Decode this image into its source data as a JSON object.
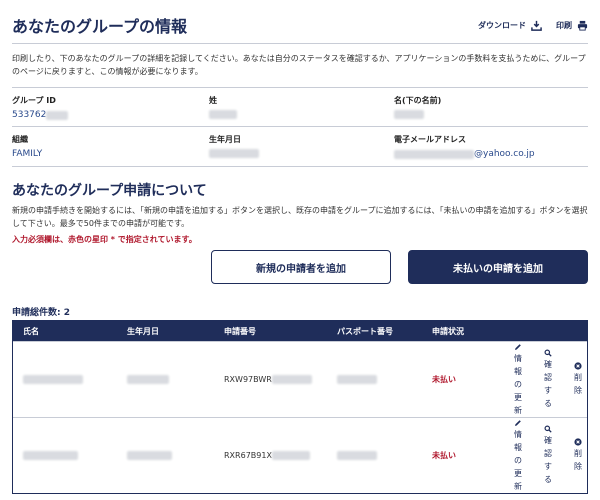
{
  "header": {
    "title": "あなたのグループの情報",
    "download_label": "ダウンロード",
    "print_label": "印刷"
  },
  "intro_text": "印刷したり、下のあなたのグループの詳細を記録してください。あなたは自分のステータスを確認するか、アプリケーションの手数料を支払うために、グループのページに戻りますと、この情報が必要になります。",
  "group_info": {
    "group_id_label": "グループ ID",
    "group_id_value": "533762",
    "surname_label": "姓",
    "given_name_label": "名(下の名前)",
    "org_label": "組織",
    "org_value": "FAMILY",
    "dob_label": "生年月日",
    "email_label": "電子メールアドレス",
    "email_value": "@yahoo.co.jp"
  },
  "applications": {
    "title": "あなたのグループ申請について",
    "description": "新規の申請手続きを開始するには、「新規の申請を追加する」ボタンを選択し、既存の申請をグループに追加するには、「未払いの申請を追加する」ボタンを選択して下さい。最多で50件までの申請が可能です。",
    "required_note": "入力必須欄は、赤色の星印 * で指定されています。",
    "add_new_label": "新規の申請者を追加",
    "add_unpaid_label": "未払いの申請を追加",
    "total_label": "申請総件数: 2"
  },
  "table": {
    "columns": [
      "氏名",
      "生年月日",
      "申請番号",
      "パスポート番号",
      "申請状況"
    ],
    "rows": [
      {
        "app_number": "RXW97BWR",
        "status": "未払い"
      },
      {
        "app_number": "RXR67B91X",
        "status": "未払い"
      }
    ],
    "actions": {
      "update_chars": [
        "情",
        "報",
        "の",
        "更",
        "新"
      ],
      "confirm_chars": [
        "確",
        "認",
        "す",
        "る"
      ],
      "delete_chars": [
        "削",
        "除"
      ]
    }
  },
  "colors": {
    "navy": "#1f2d5a",
    "required_red": "#b0182d"
  }
}
